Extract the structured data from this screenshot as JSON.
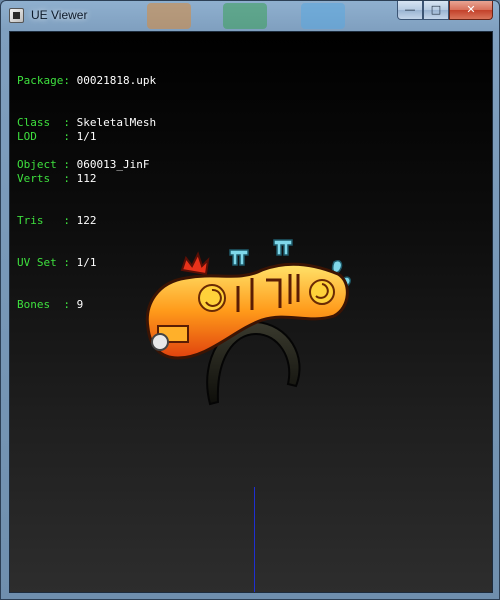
{
  "window": {
    "title": "UE Viewer",
    "minimize_glyph": "—",
    "maximize_glyph": "□",
    "close_glyph": "✕",
    "close_color": "#c3412a"
  },
  "info_block_1": [
    {
      "label": "Package:",
      "value": "00021818.upk"
    },
    {
      "label": "Class  :",
      "value": "SkeletalMesh"
    },
    {
      "label": "Object :",
      "value": "060013_JinF"
    }
  ],
  "info_block_2": [
    {
      "label": "LOD    :",
      "value": "1/1"
    },
    {
      "label": "Verts  :",
      "value": "112"
    },
    {
      "label": "Tris   :",
      "value": "122"
    },
    {
      "label": "UV Set :",
      "value": "1/1"
    },
    {
      "label": "Bones  :",
      "value": "9"
    }
  ],
  "model": {
    "text": "도와주세요",
    "description_icon": "headband-mesh"
  },
  "colors": {
    "label_green": "#3ee03e",
    "value_white": "#ffffff",
    "axis_blue": "#1f2fd0"
  }
}
